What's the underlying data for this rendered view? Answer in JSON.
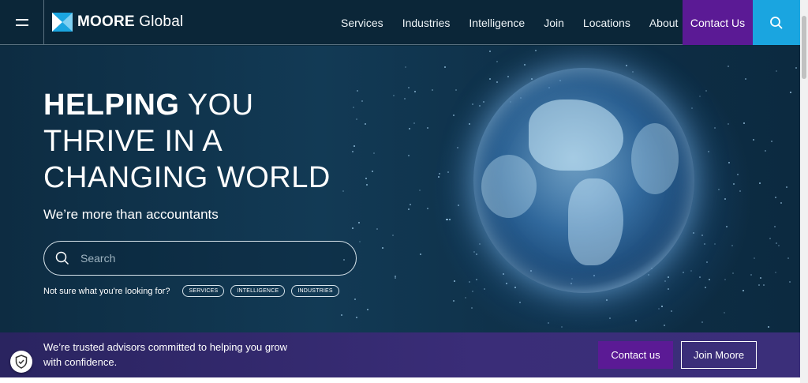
{
  "header": {
    "logo": {
      "brand": "MOORE",
      "suffix": " Global"
    },
    "nav": [
      "Services",
      "Industries",
      "Intelligence",
      "Join",
      "Locations",
      "About"
    ],
    "contact_label": "Contact Us"
  },
  "hero": {
    "headline_bold": "HELPING",
    "headline_rest1": " YOU",
    "headline_line2": "THRIVE IN A",
    "headline_line3": "CHANGING WORLD",
    "subline": "We’re more than accountants",
    "search_placeholder": "Search",
    "hint": "Not sure what you're looking for?",
    "pills": [
      "SERVICES",
      "INTELLIGENCE",
      "INDUSTRIES"
    ]
  },
  "banner": {
    "text": "We’re trusted advisors committed to helping you grow with confidence.",
    "contact_label": "Contact us",
    "join_label": "Join Moore"
  },
  "colors": {
    "header_bg": "#0b2638",
    "contact_purple": "#5b1a95",
    "search_blue": "#1aa5e0",
    "banner_bg": "#3a2d78"
  },
  "icons": [
    "hamburger-icon",
    "moore-logo-icon",
    "search-icon",
    "shield-check-icon"
  ]
}
